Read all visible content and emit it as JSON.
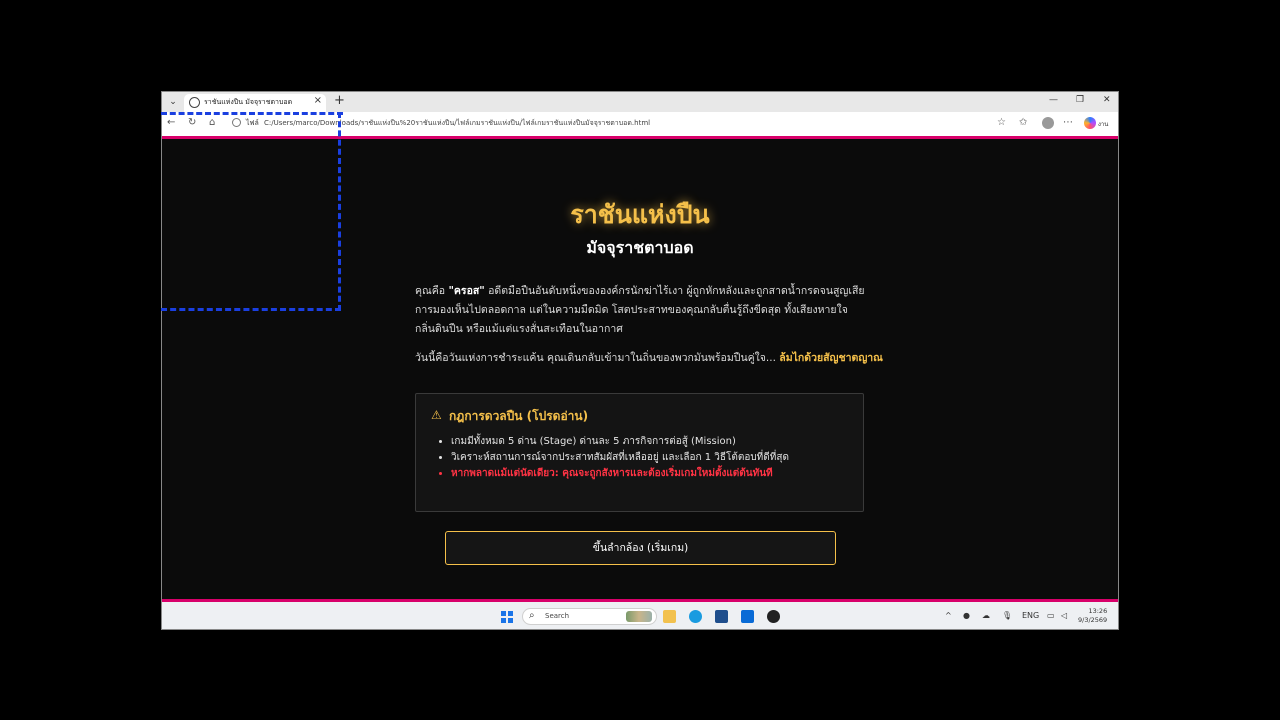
{
  "browser": {
    "tab_title": "ราชันแห่งปืน มัจจุราชตาบอด",
    "url_label": "ไฟล์",
    "url": "C:/Users/marco/Downloads/ราชันแห่งปืน%20ราชันแห่งปืน/ไฟล์เกมราชันแห่งปืน/ไฟล์เกมราชันแห่งปืนมัจจุราชตาบอด.html",
    "copilot_label": "งาน"
  },
  "page": {
    "title": "ราชันแห่งปืน",
    "subtitle": "มัจจุราชตาบอด",
    "intro_prefix": "คุณคือ ",
    "intro_name": "\"ครอส\"",
    "intro_rest": " อดีตมือปืนอันดับหนึ่งขององค์กรนักฆ่าไร้เงา ผู้ถูกหักหลังและถูกสาดน้ำกรดจนสูญเสียการมองเห็นไปตลอดกาล แต่ในความมืดมิด โสตประสาทของคุณกลับตื่นรู้ถึงขีดสุด ทั้งเสียงหายใจ กลิ่นดินปืน หรือแม้แต่แรงสั่นสะเทือนในอากาศ",
    "intro2_text": "วันนี้คือวันแห่งการชำระแค้น คุณเดินกลับเข้ามาในถิ่นของพวกมันพร้อมปืนคู่ใจ... ",
    "intro2_highlight": "ล้มไกด้วยสัญชาตญาณ",
    "rules_title": "กฎการดวลปืน (โปรดอ่าน)",
    "rules": [
      "เกมมีทั้งหมด 5 ด่าน (Stage) ด่านละ 5 ภารกิจการต่อสู้ (Mission)",
      "วิเคราะห์สถานการณ์จากประสาทสัมผัสที่เหลืออยู่ และเลือก 1 วิธีโต้ตอบที่ดีที่สุด",
      "หากพลาดแม้แต่นัดเดียว: คุณจะถูกสังหารและต้องเริ่มเกมใหม่ตั้งแต่ต้นทันที"
    ],
    "start_button": "ขึ้นลำกล้อง (เริ่มเกม)"
  },
  "taskbar": {
    "search_placeholder": "Search",
    "lang": "ENG",
    "time": "13:26",
    "date": "9/3/2569"
  },
  "colors": {
    "accent_gold": "#f5c04a",
    "danger_red": "#ff3344",
    "edge_accent": "#d8006a",
    "selection_dashed": "#1a3fe0"
  }
}
